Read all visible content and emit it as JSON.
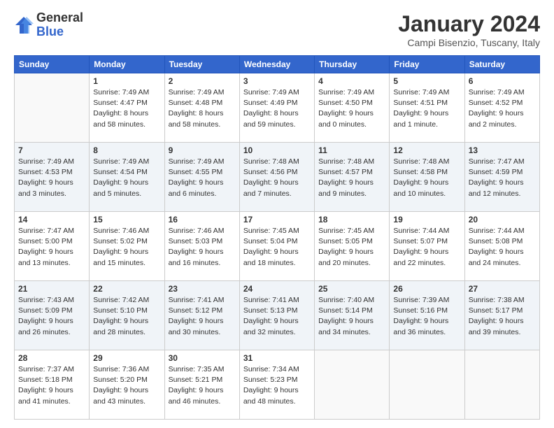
{
  "logo": {
    "general": "General",
    "blue": "Blue"
  },
  "title": "January 2024",
  "location": "Campi Bisenzio, Tuscany, Italy",
  "weekdays": [
    "Sunday",
    "Monday",
    "Tuesday",
    "Wednesday",
    "Thursday",
    "Friday",
    "Saturday"
  ],
  "weeks": [
    [
      {
        "day": "",
        "info": ""
      },
      {
        "day": "1",
        "info": "Sunrise: 7:49 AM\nSunset: 4:47 PM\nDaylight: 8 hours\nand 58 minutes."
      },
      {
        "day": "2",
        "info": "Sunrise: 7:49 AM\nSunset: 4:48 PM\nDaylight: 8 hours\nand 58 minutes."
      },
      {
        "day": "3",
        "info": "Sunrise: 7:49 AM\nSunset: 4:49 PM\nDaylight: 8 hours\nand 59 minutes."
      },
      {
        "day": "4",
        "info": "Sunrise: 7:49 AM\nSunset: 4:50 PM\nDaylight: 9 hours\nand 0 minutes."
      },
      {
        "day": "5",
        "info": "Sunrise: 7:49 AM\nSunset: 4:51 PM\nDaylight: 9 hours\nand 1 minute."
      },
      {
        "day": "6",
        "info": "Sunrise: 7:49 AM\nSunset: 4:52 PM\nDaylight: 9 hours\nand 2 minutes."
      }
    ],
    [
      {
        "day": "7",
        "info": "Sunrise: 7:49 AM\nSunset: 4:53 PM\nDaylight: 9 hours\nand 3 minutes."
      },
      {
        "day": "8",
        "info": "Sunrise: 7:49 AM\nSunset: 4:54 PM\nDaylight: 9 hours\nand 5 minutes."
      },
      {
        "day": "9",
        "info": "Sunrise: 7:49 AM\nSunset: 4:55 PM\nDaylight: 9 hours\nand 6 minutes."
      },
      {
        "day": "10",
        "info": "Sunrise: 7:48 AM\nSunset: 4:56 PM\nDaylight: 9 hours\nand 7 minutes."
      },
      {
        "day": "11",
        "info": "Sunrise: 7:48 AM\nSunset: 4:57 PM\nDaylight: 9 hours\nand 9 minutes."
      },
      {
        "day": "12",
        "info": "Sunrise: 7:48 AM\nSunset: 4:58 PM\nDaylight: 9 hours\nand 10 minutes."
      },
      {
        "day": "13",
        "info": "Sunrise: 7:47 AM\nSunset: 4:59 PM\nDaylight: 9 hours\nand 12 minutes."
      }
    ],
    [
      {
        "day": "14",
        "info": "Sunrise: 7:47 AM\nSunset: 5:00 PM\nDaylight: 9 hours\nand 13 minutes."
      },
      {
        "day": "15",
        "info": "Sunrise: 7:46 AM\nSunset: 5:02 PM\nDaylight: 9 hours\nand 15 minutes."
      },
      {
        "day": "16",
        "info": "Sunrise: 7:46 AM\nSunset: 5:03 PM\nDaylight: 9 hours\nand 16 minutes."
      },
      {
        "day": "17",
        "info": "Sunrise: 7:45 AM\nSunset: 5:04 PM\nDaylight: 9 hours\nand 18 minutes."
      },
      {
        "day": "18",
        "info": "Sunrise: 7:45 AM\nSunset: 5:05 PM\nDaylight: 9 hours\nand 20 minutes."
      },
      {
        "day": "19",
        "info": "Sunrise: 7:44 AM\nSunset: 5:07 PM\nDaylight: 9 hours\nand 22 minutes."
      },
      {
        "day": "20",
        "info": "Sunrise: 7:44 AM\nSunset: 5:08 PM\nDaylight: 9 hours\nand 24 minutes."
      }
    ],
    [
      {
        "day": "21",
        "info": "Sunrise: 7:43 AM\nSunset: 5:09 PM\nDaylight: 9 hours\nand 26 minutes."
      },
      {
        "day": "22",
        "info": "Sunrise: 7:42 AM\nSunset: 5:10 PM\nDaylight: 9 hours\nand 28 minutes."
      },
      {
        "day": "23",
        "info": "Sunrise: 7:41 AM\nSunset: 5:12 PM\nDaylight: 9 hours\nand 30 minutes."
      },
      {
        "day": "24",
        "info": "Sunrise: 7:41 AM\nSunset: 5:13 PM\nDaylight: 9 hours\nand 32 minutes."
      },
      {
        "day": "25",
        "info": "Sunrise: 7:40 AM\nSunset: 5:14 PM\nDaylight: 9 hours\nand 34 minutes."
      },
      {
        "day": "26",
        "info": "Sunrise: 7:39 AM\nSunset: 5:16 PM\nDaylight: 9 hours\nand 36 minutes."
      },
      {
        "day": "27",
        "info": "Sunrise: 7:38 AM\nSunset: 5:17 PM\nDaylight: 9 hours\nand 39 minutes."
      }
    ],
    [
      {
        "day": "28",
        "info": "Sunrise: 7:37 AM\nSunset: 5:18 PM\nDaylight: 9 hours\nand 41 minutes."
      },
      {
        "day": "29",
        "info": "Sunrise: 7:36 AM\nSunset: 5:20 PM\nDaylight: 9 hours\nand 43 minutes."
      },
      {
        "day": "30",
        "info": "Sunrise: 7:35 AM\nSunset: 5:21 PM\nDaylight: 9 hours\nand 46 minutes."
      },
      {
        "day": "31",
        "info": "Sunrise: 7:34 AM\nSunset: 5:23 PM\nDaylight: 9 hours\nand 48 minutes."
      },
      {
        "day": "",
        "info": ""
      },
      {
        "day": "",
        "info": ""
      },
      {
        "day": "",
        "info": ""
      }
    ]
  ]
}
